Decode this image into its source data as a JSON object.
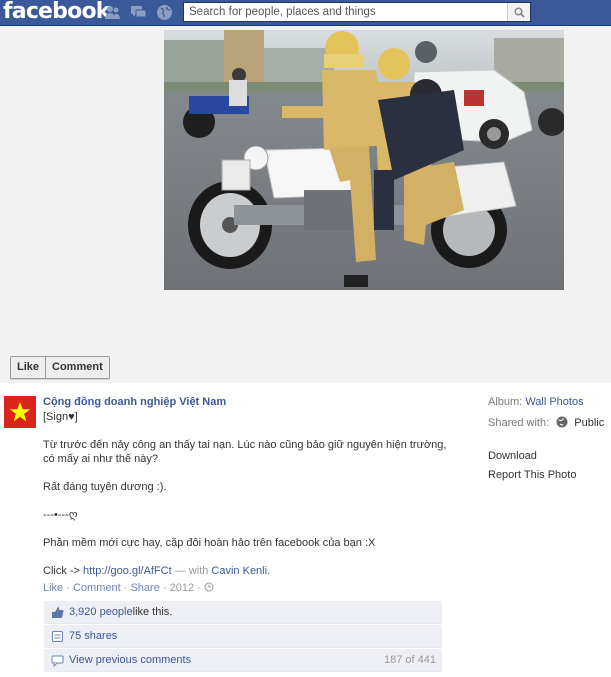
{
  "topbar": {
    "logo": "facebook",
    "search_placeholder": "Search for people, places and things",
    "icons": [
      "friend-requests-icon",
      "messages-icon",
      "notifications-icon",
      "search-icon"
    ]
  },
  "photo_actions": {
    "like": "Like",
    "comment": "Comment"
  },
  "post": {
    "author": "Cộng đồng doanh nghiệp Việt Nam",
    "signature": "[Sign♥]",
    "paragraphs": [
      "Từ trước đến nảy công an thấy tai nạn. Lúc nào cũng bảo giữ nguyên hiện trường,",
      "có mấy ai như thế này?",
      "Rất đáng tuyên dương :).",
      "---•---ღ",
      "Phần mềm mới cực hay, cặp đôi hoàn hảo trên facebook của bạn :X"
    ],
    "click_prefix": "Click -> ",
    "click_link": "http://goo.gl/AfFCt",
    "with_text": " — with ",
    "with_name": "Cavin Kenli.",
    "meta": {
      "like": "Like",
      "comment": "Comment",
      "share": "Share",
      "year": "2012"
    },
    "likes_count": "3,920 people",
    "likes_suffix": " like this.",
    "shares": "75 shares",
    "view_prev": "View previous comments",
    "comment_count": "187 of 441"
  },
  "sidebar": {
    "album_label": "Album:",
    "album_value": "Wall Photos",
    "shared_label": "Shared with:",
    "shared_value": "Public",
    "download": "Download",
    "report": "Report This Photo"
  },
  "colors": {
    "fb_blue": "#3b5998",
    "link": "#3b5998",
    "muted": "#999999",
    "flag_red": "#da251d",
    "flag_star": "#ffff00"
  }
}
